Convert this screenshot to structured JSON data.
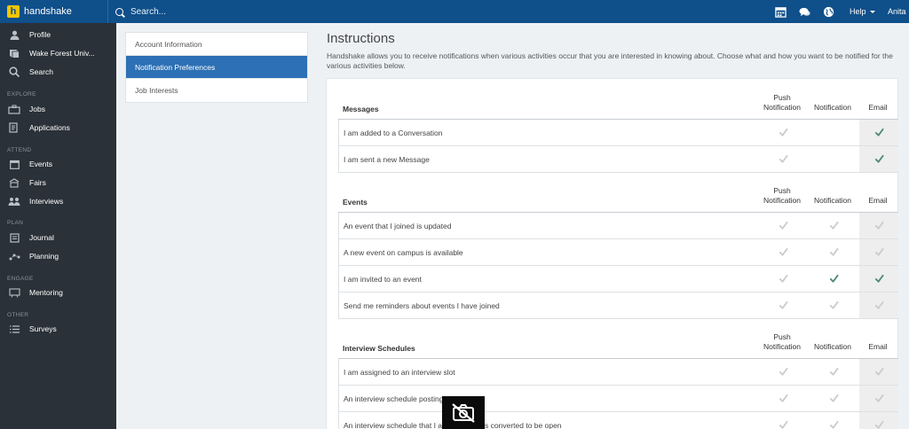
{
  "brand": {
    "name": "handshake",
    "logo_letter": "h"
  },
  "search": {
    "placeholder": "Search..."
  },
  "topbar": {
    "icons": [
      "calendar-icon",
      "chat-icon",
      "globe-icon"
    ],
    "help_label": "Help",
    "user_name": "Anita"
  },
  "sidebar": {
    "top_items": [
      {
        "label": "Profile",
        "icon": "person-icon"
      },
      {
        "label": "Wake Forest Univ...",
        "icon": "book-icon"
      },
      {
        "label": "Search",
        "icon": "search-icon"
      }
    ],
    "sections": {
      "explore": "EXPLORE",
      "attend": "ATTEND",
      "plan": "PLAN",
      "engage": "ENGAGE",
      "other": "OTHER"
    },
    "explore_items": [
      {
        "label": "Jobs",
        "icon": "briefcase-icon"
      },
      {
        "label": "Applications",
        "icon": "document-icon"
      }
    ],
    "attend_items": [
      {
        "label": "Events",
        "icon": "calendar-icon"
      },
      {
        "label": "Fairs",
        "icon": "booth-icon"
      },
      {
        "label": "Interviews",
        "icon": "people-icon"
      }
    ],
    "plan_items": [
      {
        "label": "Journal",
        "icon": "journal-icon"
      },
      {
        "label": "Planning",
        "icon": "route-icon"
      }
    ],
    "engage_items": [
      {
        "label": "Mentoring",
        "icon": "mentor-icon"
      }
    ],
    "other_items": [
      {
        "label": "Surveys",
        "icon": "list-icon"
      }
    ]
  },
  "subnav": {
    "items": [
      "Account Information",
      "Notification Preferences",
      "Job Interests"
    ],
    "active": "Notification Preferences"
  },
  "main": {
    "title": "Instructions",
    "description": "Handshake allows you to receive notifications when various activities occur that you are interested in knowing about. Choose what and how you want to be notified for the various activities below.",
    "columns": {
      "push_line1": "Push",
      "push_line2": "Notification",
      "notification": "Notification",
      "email": "Email"
    },
    "sections": [
      {
        "title": "Messages",
        "has_notification_column": false,
        "rows": [
          {
            "label": "I am added to a Conversation",
            "push": false,
            "email": true
          },
          {
            "label": "I am sent a new Message",
            "push": false,
            "email": true
          }
        ]
      },
      {
        "title": "Events",
        "has_notification_column": true,
        "rows": [
          {
            "label": "An event that I joined is updated",
            "push": false,
            "notification": false,
            "email": false
          },
          {
            "label": "A new event on campus is available",
            "push": false,
            "notification": false,
            "email": false
          },
          {
            "label": "I am invited to an event",
            "push": false,
            "notification": true,
            "email": true
          },
          {
            "label": "Send me reminders about events I have joined",
            "push": false,
            "notification": false,
            "email": false
          }
        ]
      },
      {
        "title": "Interview Schedules",
        "has_notification_column": true,
        "rows": [
          {
            "label": "I am assigned to an interview slot",
            "push": false,
            "notification": false,
            "email": false
          },
          {
            "label": "An interview schedule posting",
            "push": false,
            "notification": false,
            "email": false
          },
          {
            "label": "An interview schedule that I a",
            "label_tail": "s converted to be open",
            "push": false,
            "notification": false,
            "email": false
          }
        ]
      }
    ]
  },
  "overlay": {
    "icon": "camera-off-icon"
  },
  "colors": {
    "topbar": "#0f4f8a",
    "sidebar": "#2a3138",
    "active_nav": "#2d70b5",
    "check_on": "#4f8a76",
    "check_off": "#c9cdd1"
  }
}
